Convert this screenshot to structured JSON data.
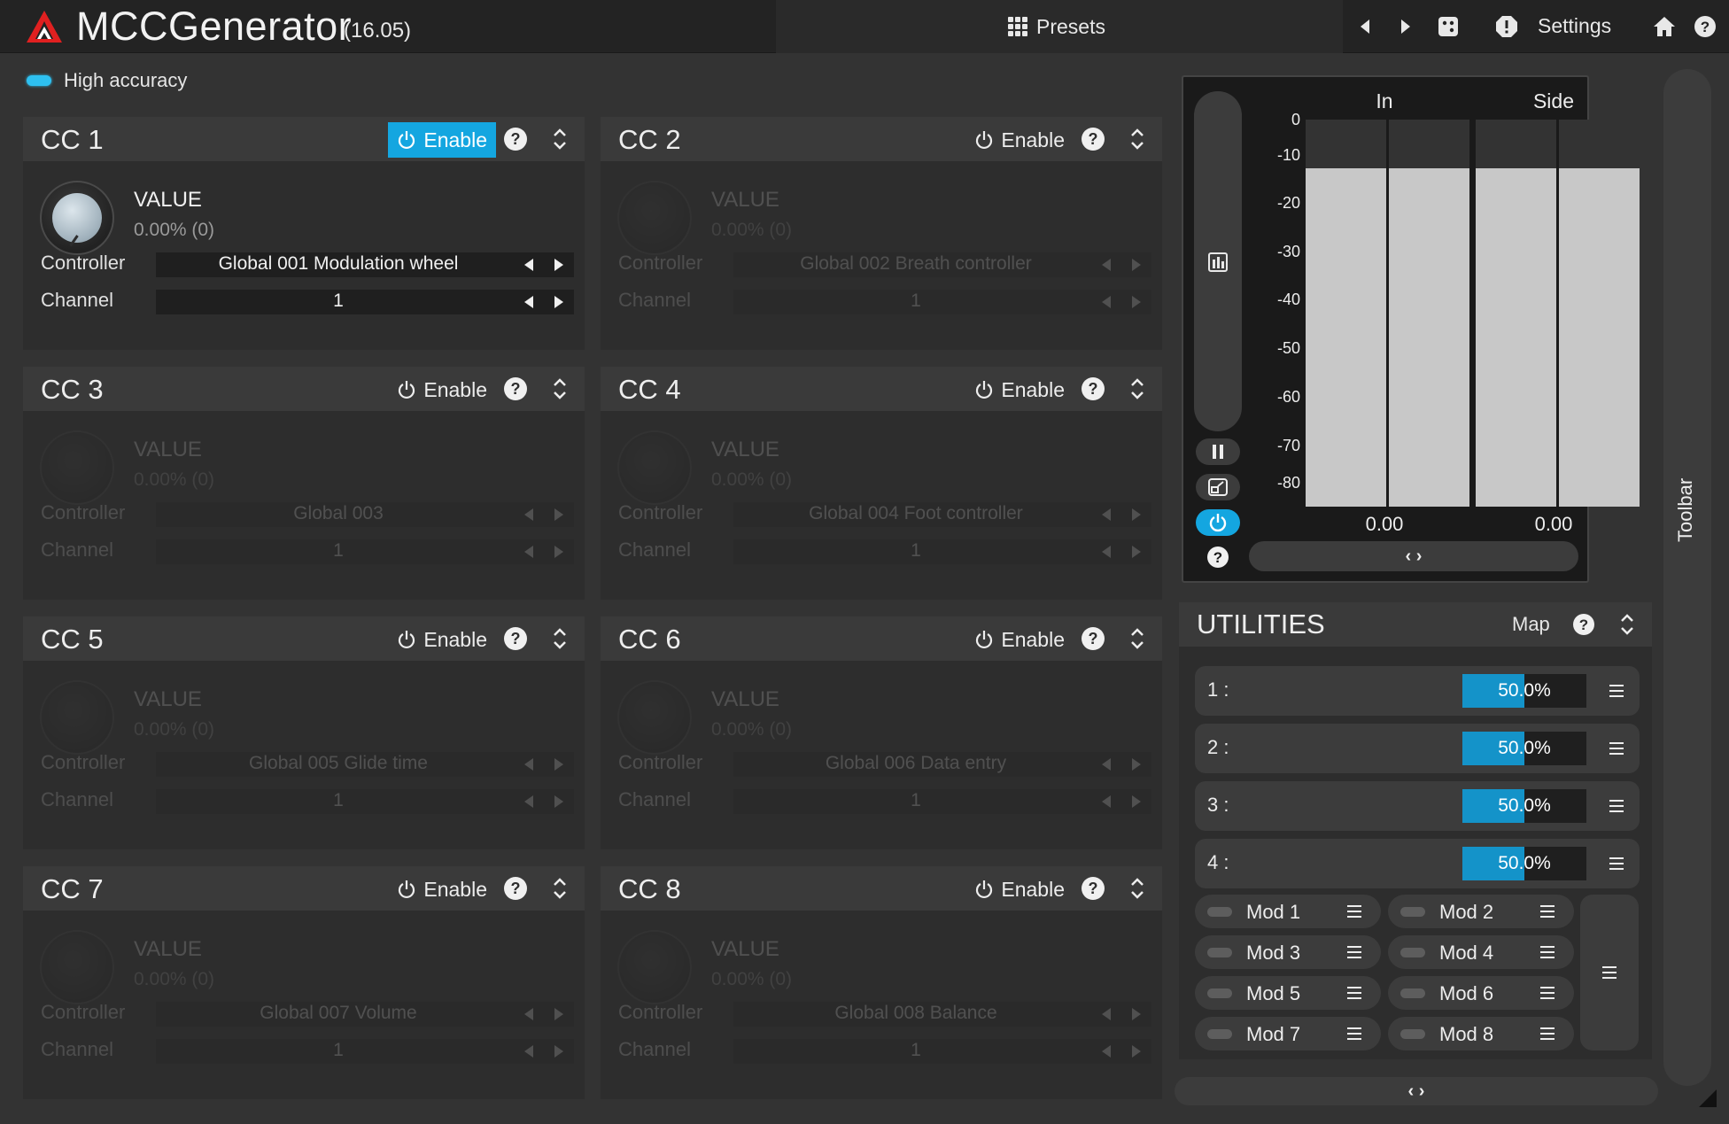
{
  "app": {
    "title": "MCCGenerator",
    "version": "(16.05)",
    "accent": "#14a6e0"
  },
  "toolbar": {
    "presets_label": "Presets",
    "settings_label": "Settings",
    "side_label": "Toolbar",
    "icons": [
      "grid-icon",
      "arrow-left-icon",
      "arrow-right-icon",
      "dice-icon",
      "alert-icon",
      "home-icon",
      "help-icon"
    ]
  },
  "accuracy": {
    "label": "High accuracy",
    "enabled": true
  },
  "cc_panels": [
    {
      "title": "CC 1",
      "enable_label": "Enable",
      "enabled": true,
      "value_label": "VALUE",
      "value_text": "0.00% (0)",
      "controller_label": "Controller",
      "controller_value": "Global 001 Modulation wheel",
      "channel_label": "Channel",
      "channel_value": "1"
    },
    {
      "title": "CC 2",
      "enable_label": "Enable",
      "enabled": false,
      "value_label": "VALUE",
      "value_text": "0.00% (0)",
      "controller_label": "Controller",
      "controller_value": "Global 002 Breath controller",
      "channel_label": "Channel",
      "channel_value": "1"
    },
    {
      "title": "CC 3",
      "enable_label": "Enable",
      "enabled": false,
      "value_label": "VALUE",
      "value_text": "0.00% (0)",
      "controller_label": "Controller",
      "controller_value": "Global 003",
      "channel_label": "Channel",
      "channel_value": "1"
    },
    {
      "title": "CC 4",
      "enable_label": "Enable",
      "enabled": false,
      "value_label": "VALUE",
      "value_text": "0.00% (0)",
      "controller_label": "Controller",
      "controller_value": "Global 004 Foot controller",
      "channel_label": "Channel",
      "channel_value": "1"
    },
    {
      "title": "CC 5",
      "enable_label": "Enable",
      "enabled": false,
      "value_label": "VALUE",
      "value_text": "0.00% (0)",
      "controller_label": "Controller",
      "controller_value": "Global 005 Glide time",
      "channel_label": "Channel",
      "channel_value": "1"
    },
    {
      "title": "CC 6",
      "enable_label": "Enable",
      "enabled": false,
      "value_label": "VALUE",
      "value_text": "0.00% (0)",
      "controller_label": "Controller",
      "controller_value": "Global 006 Data entry",
      "channel_label": "Channel",
      "channel_value": "1"
    },
    {
      "title": "CC 7",
      "enable_label": "Enable",
      "enabled": false,
      "value_label": "VALUE",
      "value_text": "0.00% (0)",
      "controller_label": "Controller",
      "controller_value": "Global 007 Volume",
      "channel_label": "Channel",
      "channel_value": "1"
    },
    {
      "title": "CC 8",
      "enable_label": "Enable",
      "enabled": false,
      "value_label": "VALUE",
      "value_text": "0.00% (0)",
      "controller_label": "Controller",
      "controller_value": "Global 008 Balance",
      "channel_label": "Channel",
      "channel_value": "1"
    }
  ],
  "meter": {
    "channels": [
      "In",
      "Side"
    ],
    "scale": [
      "0",
      "-10",
      "-20",
      "-30",
      "-40",
      "-50",
      "-60",
      "-70",
      "-80"
    ],
    "readouts": [
      "0.00",
      "0.00"
    ],
    "level_db": [
      -10,
      -10,
      -10,
      -10
    ],
    "range_db": [
      -80,
      0
    ]
  },
  "utilities": {
    "title": "UTILITIES",
    "map_label": "Map",
    "rows": [
      {
        "label": "1 :",
        "value_text": "50.0%",
        "value": 0.5
      },
      {
        "label": "2 :",
        "value_text": "50.0%",
        "value": 0.5
      },
      {
        "label": "3 :",
        "value_text": "50.0%",
        "value": 0.5
      },
      {
        "label": "4 :",
        "value_text": "50.0%",
        "value": 0.5
      }
    ],
    "mods": [
      "Mod 1",
      "Mod 2",
      "Mod 3",
      "Mod 4",
      "Mod 5",
      "Mod 6",
      "Mod 7",
      "Mod 8"
    ]
  }
}
